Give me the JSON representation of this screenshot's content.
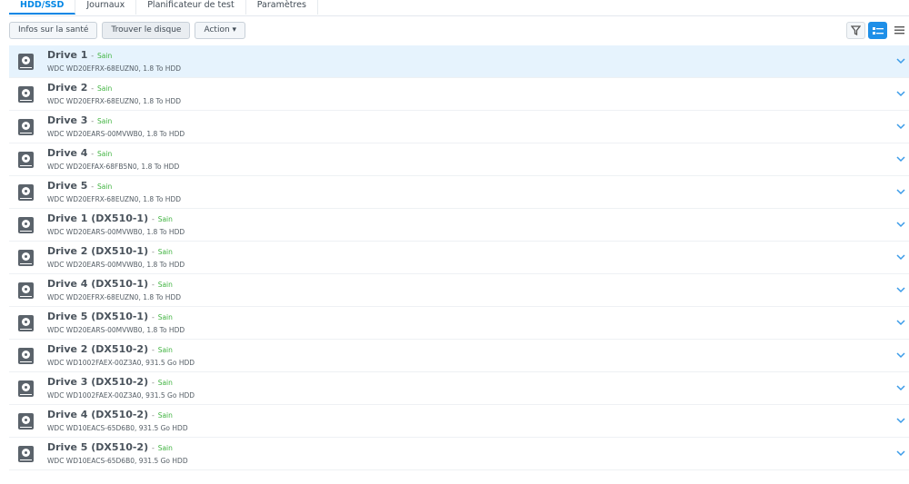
{
  "tabs": [
    "HDD/SSD",
    "Journaux",
    "Planificateur de test",
    "Paramètres"
  ],
  "toolbar": {
    "health": "Infos sur la santé",
    "find": "Trouver le disque",
    "action": "Action ▾"
  },
  "view_icons": [
    "filter-icon",
    "detail-view-icon",
    "list-view-icon"
  ],
  "status_color": "#3fb33f",
  "drives": [
    {
      "name": "Drive 1",
      "status": "Sain",
      "desc": "WDC WD20EFRX-68EUZN0, 1.8 To HDD"
    },
    {
      "name": "Drive 2",
      "status": "Sain",
      "desc": "WDC WD20EFRX-68EUZN0, 1.8 To HDD"
    },
    {
      "name": "Drive 3",
      "status": "Sain",
      "desc": "WDC WD20EARS-00MVWB0, 1.8 To HDD"
    },
    {
      "name": "Drive 4",
      "status": "Sain",
      "desc": "WDC WD20EFAX-68FB5N0, 1.8 To HDD"
    },
    {
      "name": "Drive 5",
      "status": "Sain",
      "desc": "WDC WD20EFRX-68EUZN0, 1.8 To HDD"
    },
    {
      "name": "Drive 1 (DX510-1)",
      "status": "Sain",
      "desc": "WDC WD20EARS-00MVWB0, 1.8 To HDD"
    },
    {
      "name": "Drive 2 (DX510-1)",
      "status": "Sain",
      "desc": "WDC WD20EARS-00MVWB0, 1.8 To HDD"
    },
    {
      "name": "Drive 4 (DX510-1)",
      "status": "Sain",
      "desc": "WDC WD20EFRX-68EUZN0, 1.8 To HDD"
    },
    {
      "name": "Drive 5 (DX510-1)",
      "status": "Sain",
      "desc": "WDC WD20EARS-00MVWB0, 1.8 To HDD"
    },
    {
      "name": "Drive 2 (DX510-2)",
      "status": "Sain",
      "desc": "WDC WD1002FAEX-00Z3A0, 931.5 Go HDD"
    },
    {
      "name": "Drive 3 (DX510-2)",
      "status": "Sain",
      "desc": "WDC WD1002FAEX-00Z3A0, 931.5 Go HDD"
    },
    {
      "name": "Drive 4 (DX510-2)",
      "status": "Sain",
      "desc": "WDC WD10EACS-65D6B0, 931.5 Go HDD"
    },
    {
      "name": "Drive 5 (DX510-2)",
      "status": "Sain",
      "desc": "WDC WD10EACS-65D6B0, 931.5 Go HDD"
    }
  ]
}
